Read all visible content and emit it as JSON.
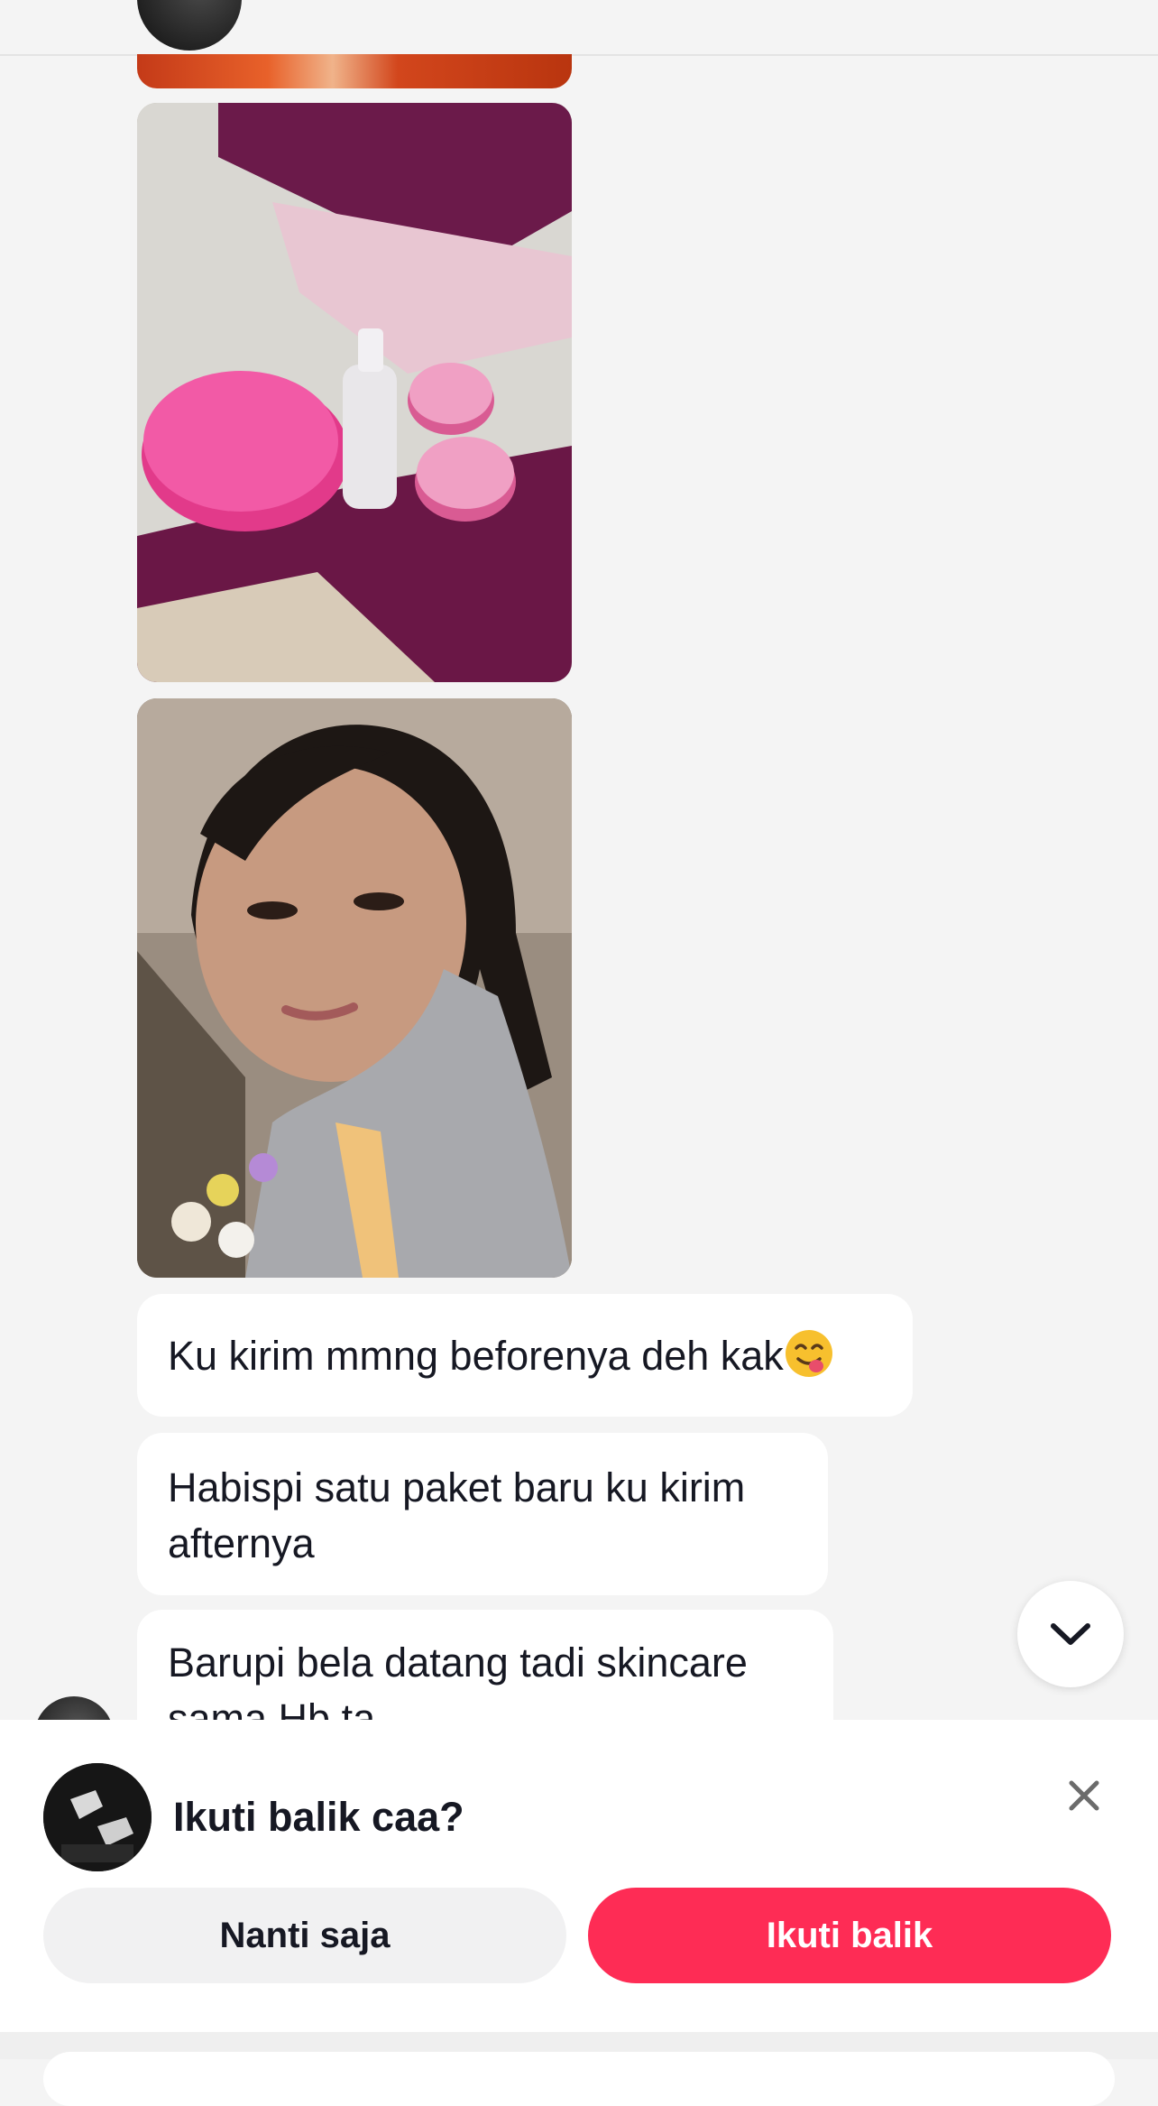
{
  "header": {
    "back_icon": "chevron-left-icon",
    "save_icon": "bookmark-icon",
    "more_icon": "more-icon"
  },
  "messages": [
    {
      "type": "image",
      "description": ""
    },
    {
      "type": "image",
      "description": ""
    },
    {
      "type": "image",
      "description": ""
    },
    {
      "type": "text",
      "text": "Ku kirim mmng beforenya deh kak",
      "emoji": "yum-face-emoji"
    },
    {
      "type": "text",
      "text": "Habispi satu paket baru ku kirim afternya"
    },
    {
      "type": "text",
      "text": "Barupi bela datang tadi skincare sama Hb ta"
    }
  ],
  "scroll_button_icon": "chevron-down-icon",
  "follow_sheet": {
    "prompt": "Ikuti balik caa?",
    "later_label": "Nanti saja",
    "follow_label": "Ikuti balik",
    "close_icon": "close-icon"
  },
  "colors": {
    "accent": "#fe2c55",
    "background": "#f4f4f4",
    "bubble": "#ffffff"
  }
}
